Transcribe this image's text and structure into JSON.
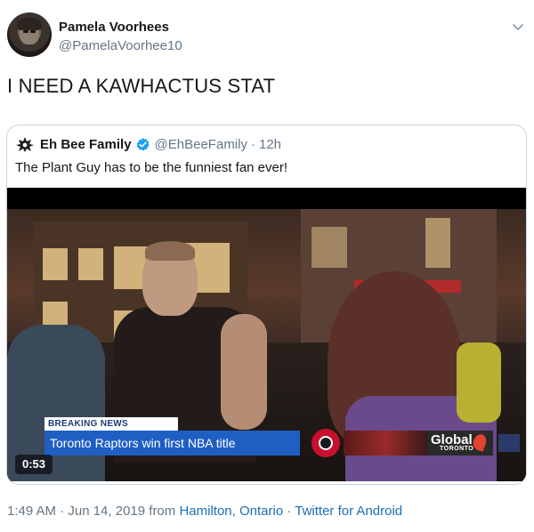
{
  "tweet": {
    "display_name": "Pamela Voorhees",
    "handle": "@PamelaVoorhee10",
    "text": "I NEED A KAWHACTUS STAT"
  },
  "quoted_tweet": {
    "display_name": "Eh Bee Family",
    "handle": "@EhBeeFamily",
    "separator": "·",
    "time": "12h",
    "text": "The Plant Guy has to be the funniest fan ever!",
    "video": {
      "breaking_label": "BREAKING NEWS",
      "headline": "Toronto Raptors win first NBA title",
      "network": "Global",
      "network_sub": "TORONTO",
      "duration": "0:53"
    }
  },
  "footer": {
    "timestamp": "1:49 AM · Jun 14, 2019 from",
    "location": "Hamilton, Ontario",
    "separator": "·",
    "source": "Twitter for Android"
  },
  "colors": {
    "link": "#1b6fb5",
    "secondary_text": "#657786",
    "verified": "#1da1f2",
    "ticker": "#1f5fc4"
  },
  "icons": [
    "avatar",
    "chevron-down-icon",
    "eh-bee-logo-icon",
    "verified-badge-icon",
    "raptors-logo-icon",
    "global-logo-icon"
  ]
}
